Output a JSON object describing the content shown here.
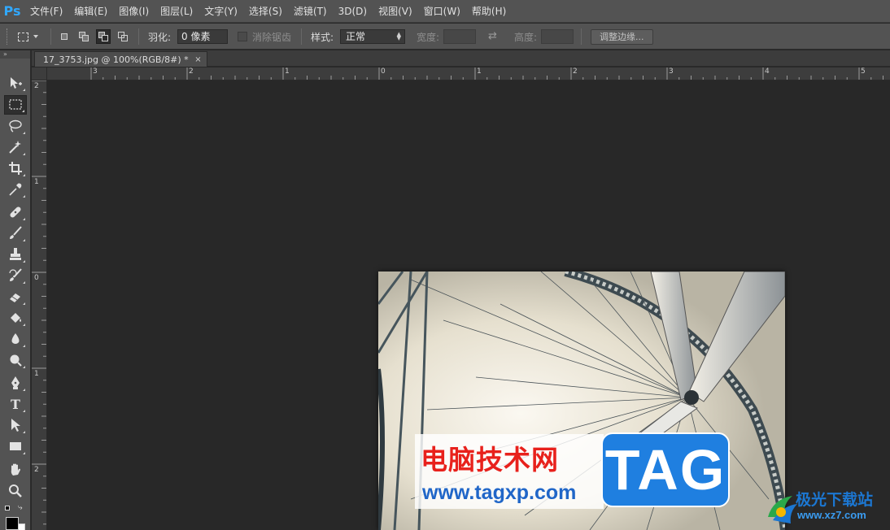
{
  "app": {
    "logo_text": "Ps"
  },
  "menu": [
    {
      "label": "文件(F)"
    },
    {
      "label": "编辑(E)"
    },
    {
      "label": "图像(I)"
    },
    {
      "label": "图层(L)"
    },
    {
      "label": "文字(Y)"
    },
    {
      "label": "选择(S)"
    },
    {
      "label": "滤镜(T)"
    },
    {
      "label": "3D(D)"
    },
    {
      "label": "视图(V)"
    },
    {
      "label": "窗口(W)"
    },
    {
      "label": "帮助(H)"
    }
  ],
  "options": {
    "feather_label": "羽化:",
    "feather_value": "0 像素",
    "antialias_label": "消除锯齿",
    "style_label": "样式:",
    "style_value": "正常",
    "width_label": "宽度:",
    "height_label": "高度:",
    "refine_edge_label": "调整边缘..."
  },
  "document": {
    "tab_title": "17_3753.jpg @ 100%(RGB/8#) *",
    "close_glyph": "×"
  },
  "rulers": {
    "horizontal_labels": [
      "3",
      "2",
      "1",
      "0",
      "1",
      "2",
      "3",
      "4",
      "5"
    ],
    "vertical_labels": [
      "2",
      "1",
      "0",
      "1",
      "2"
    ]
  },
  "tools": [
    {
      "name": "move-tool-icon"
    },
    {
      "name": "rectangular-marquee-tool-icon"
    },
    {
      "name": "lasso-tool-icon"
    },
    {
      "name": "magic-wand-tool-icon"
    },
    {
      "name": "crop-tool-icon"
    },
    {
      "name": "eyedropper-tool-icon"
    },
    {
      "name": "healing-brush-tool-icon"
    },
    {
      "name": "brush-tool-icon"
    },
    {
      "name": "clone-stamp-tool-icon"
    },
    {
      "name": "history-brush-tool-icon"
    },
    {
      "name": "eraser-tool-icon"
    },
    {
      "name": "paint-bucket-tool-icon"
    },
    {
      "name": "blur-tool-icon"
    },
    {
      "name": "dodge-tool-icon"
    },
    {
      "name": "pen-tool-icon"
    },
    {
      "name": "type-tool-icon"
    },
    {
      "name": "path-selection-tool-icon"
    },
    {
      "name": "rectangle-tool-icon"
    },
    {
      "name": "hand-tool-icon"
    },
    {
      "name": "zoom-tool-icon"
    }
  ],
  "type_tool_glyph": "T",
  "watermark": {
    "cn_text": "电脑技术网",
    "url_text": "www.tagxp.com",
    "tag_text": "TAG",
    "site_cn": "极光下载站",
    "site_url": "www.xz7.com"
  },
  "colors": {
    "foreground": "#000000",
    "background": "#ffffff",
    "accent": "#31a8ff"
  }
}
